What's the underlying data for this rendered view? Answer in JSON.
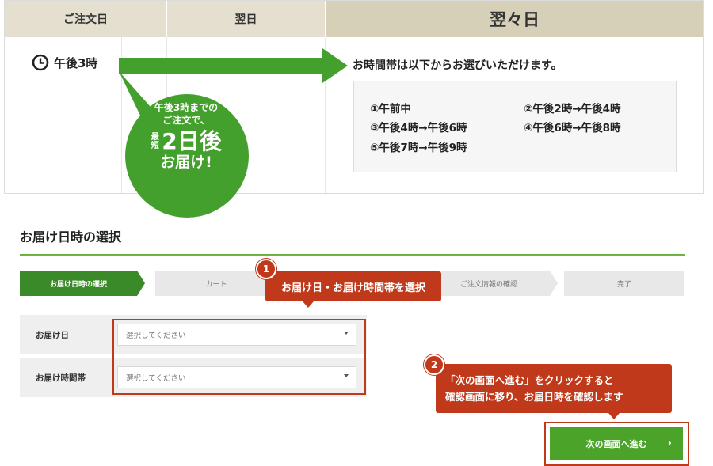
{
  "delivery": {
    "col_order_day": "ご注文日",
    "col_next_day": "翌日",
    "col_day_after": "翌々日",
    "order_time": "午後3時",
    "bubble": {
      "line1": "午後3時までの",
      "line2": "ご注文で、",
      "shortest": "最短",
      "two_days": "2日後",
      "deliver": "お届け!"
    },
    "timeslot_title": "お時間帯は以下からお選びいただけます。",
    "slots": [
      "①午前中",
      "②午後2時→午後4時",
      "③午後4時→午後6時",
      "④午後6時→午後8時",
      "⑤午後7時→午後9時"
    ]
  },
  "section": {
    "title": "お届け日時の選択"
  },
  "steps": [
    "お届け日時の選択",
    "カート",
    "ご注文情報の確認",
    "完了"
  ],
  "form": {
    "rows": [
      {
        "label": "お届け日",
        "placeholder": "選択してください"
      },
      {
        "label": "お届け時間帯",
        "placeholder": "選択してください"
      }
    ]
  },
  "callouts": {
    "c1": {
      "number": "1",
      "text": "お届け日・お届け時間帯を選択"
    },
    "c2": {
      "number": "2",
      "line1": "「次の画面へ進む」をクリックすると",
      "line2": "確認画面に移り、お届日時を確認します"
    }
  },
  "next_button": {
    "label": "次の画面へ進む",
    "chevron": "›"
  },
  "colors": {
    "green_dark": "#3b8a29",
    "green": "#4ba32a",
    "accent_red": "#c0391b",
    "header_beige": "#e4dfce"
  }
}
